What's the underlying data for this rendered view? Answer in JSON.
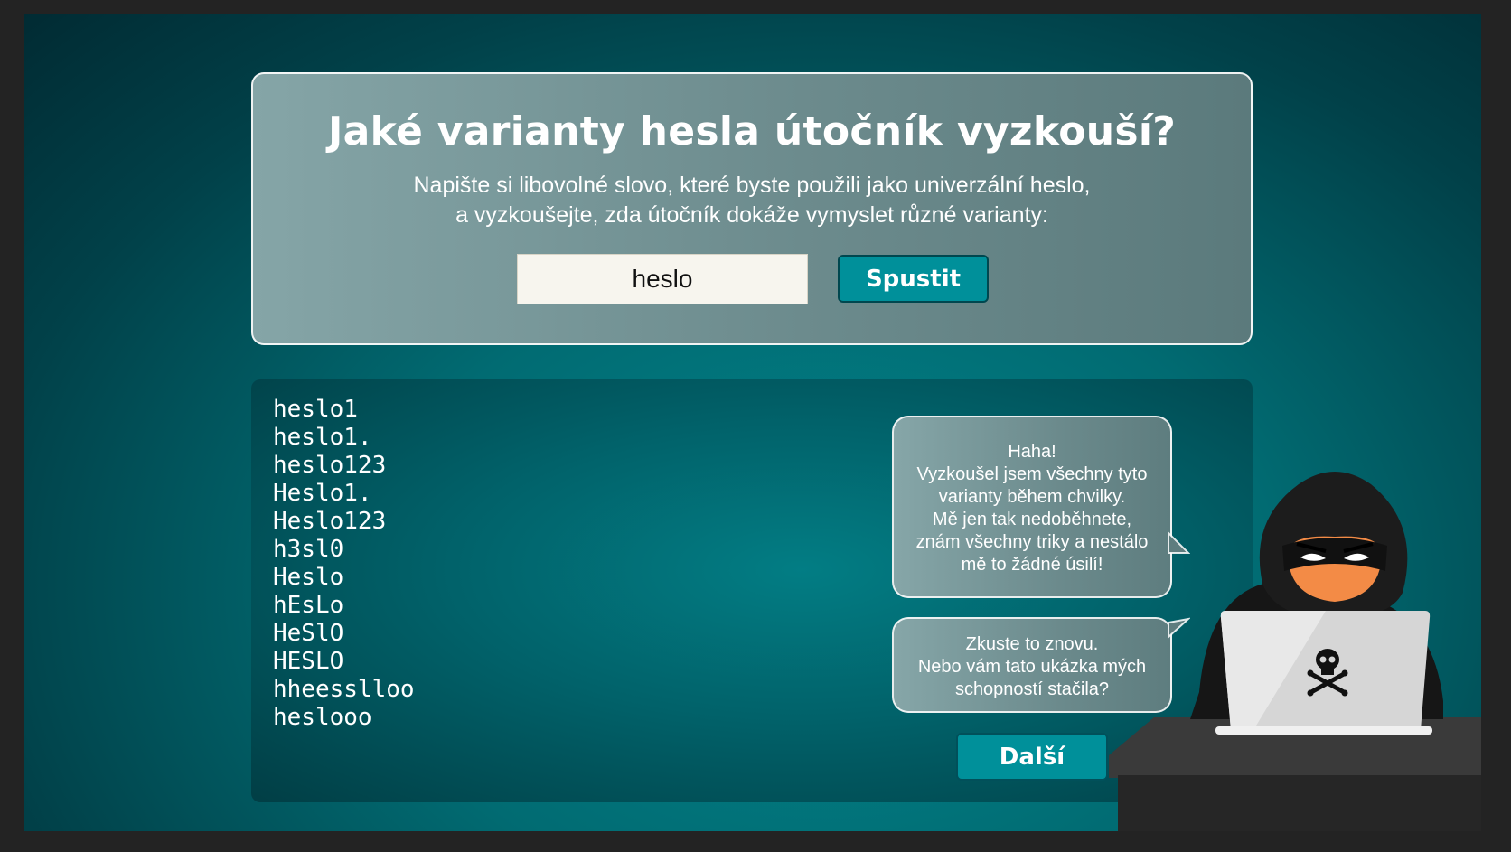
{
  "card": {
    "title": "Jaké varianty hesla útočník vyzkouší?",
    "description_line1": "Napište si libovolné slovo, které byste použili jako univerzální heslo,",
    "description_line2": "a vyzkoušejte, zda útočník dokáže vymyslet různé varianty:",
    "input_value": "heslo",
    "run_label": "Spustit"
  },
  "variants": [
    "heslo1",
    "heslo1.",
    "heslo123",
    "Heslo1.",
    "Heslo123",
    "h3sl0",
    "Heslo",
    "hEsLo",
    "HeSlO",
    "HESLO",
    "hheesslloo",
    "heslooo"
  ],
  "bubble1": {
    "lines": [
      "Haha!",
      "Vyzkoušel jsem všechny tyto",
      "varianty během chvilky.",
      "Mě jen tak nedoběhnete,",
      "znám všechny triky a nestálo",
      "mě to žádné úsilí!"
    ]
  },
  "bubble2": {
    "lines": [
      "Zkuste to znovu.",
      "Nebo vám tato ukázka mých",
      "schopností stačila?"
    ]
  },
  "next_label": "Další",
  "icons": {
    "laptop_logo": "skull-crossbones-icon"
  },
  "colors": {
    "accent": "#00909a",
    "background": "#016b72"
  }
}
